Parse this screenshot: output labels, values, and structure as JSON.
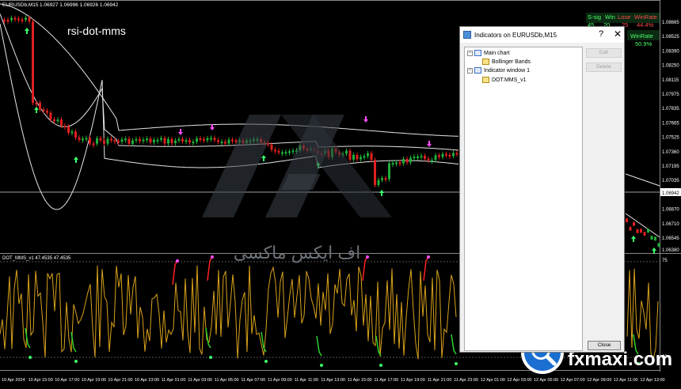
{
  "chart_header": {
    "symbol": "EURUSDb,M15",
    "ohlc": "1.06927 1.06996 1.06926 1.06942"
  },
  "chart_caption": "rsi-dot-mms",
  "price_axis": {
    "ticks": [
      "1.08665",
      "1.08525",
      "1.08390",
      "1.08250",
      "1.08115",
      "1.07975",
      "1.07835",
      "1.07665",
      "1.07525",
      "1.07360",
      "1.07195",
      "1.07035",
      "1.06942",
      "1.06870",
      "1.06710",
      "1.06545",
      "1.06380"
    ],
    "current_price": "1.06942"
  },
  "subwindow": {
    "label": "DOT_MMS_v1 47.4535 47.4535",
    "axis_top": "75",
    "axis_bottom": "20"
  },
  "time_axis": [
    "10 Apr 2024",
    "10 Apr 15:00",
    "10 Apr 17:00",
    "10 Apr 19:00",
    "10 Apr 21:00",
    "10 Apr 23:00",
    "11 Apr 01:00",
    "11 Apr 03:00",
    "11 Apr 05:00",
    "11 Apr 07:00",
    "11 Apr 09:00",
    "11 Apr 11:00",
    "11 Apr 13:00",
    "11 Apr 15:00",
    "11 Apr 17:00",
    "11 Apr 19:00",
    "11 Apr 21:00",
    "11 Apr 23:00",
    "12 Apr 01:00",
    "12 Apr 03:00",
    "12 Apr 05:00",
    "12 Apr 07:00",
    "12 Apr 09:00",
    "12 Apr 11:00",
    "12 Apr 13:00"
  ],
  "stats_box": {
    "row1": {
      "s_sig": "S-sig",
      "win": "Win",
      "lose": "Lose",
      "winrate": "WinRate"
    },
    "row1_vals": {
      "s_sig": "45",
      "win": "20",
      "lose": "25",
      "winrate": "44.4%"
    },
    "row2": {
      "winrate": "WinRate"
    },
    "row2_vals": {
      "winrate": "50.9%"
    }
  },
  "dialog": {
    "title": "Indicators on EURUSDb,M15",
    "help": "?",
    "close_x": "✕",
    "tree": {
      "main_chart": "Main chart",
      "bollinger": "Bollinger Bands",
      "indicator_window": "Indicator window 1",
      "dot_mms": "DOT.MMS_v1"
    },
    "buttons": {
      "edit": "Edit",
      "delete": "Delete",
      "close": "Close"
    }
  },
  "watermark": {
    "logo_text": "fxmaxi.com",
    "arabic": "اف ایکس ماکسی"
  },
  "colors": {
    "bull": "#1fae3a",
    "bear": "#e02020",
    "band": "#e6e6e6",
    "osc": "#d9a21b",
    "osc_green": "#2ed12e",
    "osc_red": "#ff2020",
    "buy_arrow": "#3bff6a",
    "sell_arrow": "#ff4dff"
  }
}
